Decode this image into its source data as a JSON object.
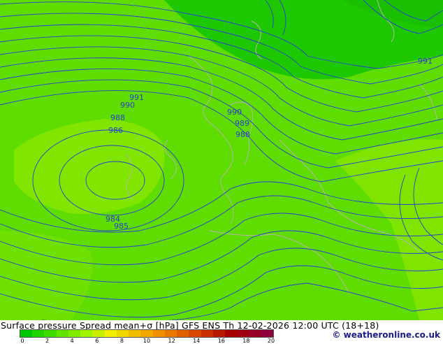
{
  "map": {
    "isobar_labels": [
      "991",
      "990",
      "988",
      "986",
      "990",
      "989",
      "988",
      "984",
      "985",
      "991"
    ],
    "colors": {
      "background": "#5fdc00",
      "dark_green": "#1ec800",
      "light_green": "#80e600",
      "isobar": "#2b3fd0",
      "coastline": "#b4b4b4"
    }
  },
  "footer": {
    "caption": "Surface pressure Spread mean+σ [hPa] GFS ENS  Th 12-02-2026 12:00 UTC (18+18)",
    "credit": "© weatheronline.co.uk",
    "scale_colors": [
      "#00c800",
      "#20d400",
      "#40dc00",
      "#60e400",
      "#80ec00",
      "#a0f400",
      "#c8f000",
      "#f0f000",
      "#f0d800",
      "#f0c000",
      "#f0a800",
      "#f09000",
      "#e87800",
      "#e06000",
      "#d84800",
      "#c83000",
      "#b81800",
      "#a80000",
      "#a00010",
      "#980028",
      "#900040"
    ],
    "scale_ticks": [
      "0",
      "2",
      "4",
      "6",
      "8",
      "10",
      "12",
      "14",
      "16",
      "18",
      "20"
    ]
  }
}
